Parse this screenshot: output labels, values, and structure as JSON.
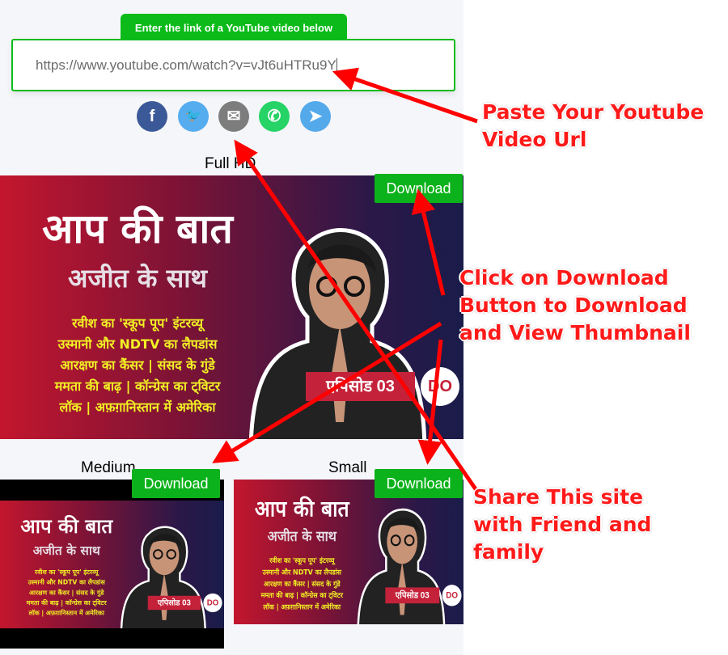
{
  "header": {
    "tab_label": "Enter the link of a YouTube video below",
    "url_value": "https://www.youtube.com/watch?v=vJt6uHTRu9Y"
  },
  "share": [
    {
      "icon": "facebook-icon",
      "glyph": "f",
      "color": "#3b5998"
    },
    {
      "icon": "twitter-icon",
      "glyph": "🐦",
      "color": "#55acee"
    },
    {
      "icon": "email-icon",
      "glyph": "✉",
      "color": "#7d7d7d"
    },
    {
      "icon": "whatsapp-icon",
      "glyph": "✆",
      "color": "#25d366"
    },
    {
      "icon": "telegram-icon",
      "glyph": "➤",
      "color": "#54a9eb"
    }
  ],
  "sections": {
    "full": "Full HD",
    "medium": "Medium",
    "small": "Small",
    "download_label": "Download"
  },
  "thumbnail": {
    "title": "आप की बात",
    "subtitle": "अजीत के साथ",
    "lines": [
      "रवीश का 'स्कूप पूप' इंटरव्यू",
      "उस्मानी और NDTV का लैपडांस",
      "आरक्षण का कैंसर | संसद के गुंडे",
      "ममता की बाढ़ | कॉन्ग्रेस का ट्विटर",
      "लॉक | अफ़ग़ानिस्तान में अमेरिका"
    ],
    "episode": "एपिसोड 03",
    "logo": "DO"
  },
  "annotations": {
    "paste": "Paste Your Youtube Video Url",
    "click": "Click on Download Button to Download and View Thumbnail",
    "share": "Share This site with Friend and family"
  },
  "colors": {
    "accent": "#0cbb1a",
    "annotation": "#ff1a1a"
  }
}
